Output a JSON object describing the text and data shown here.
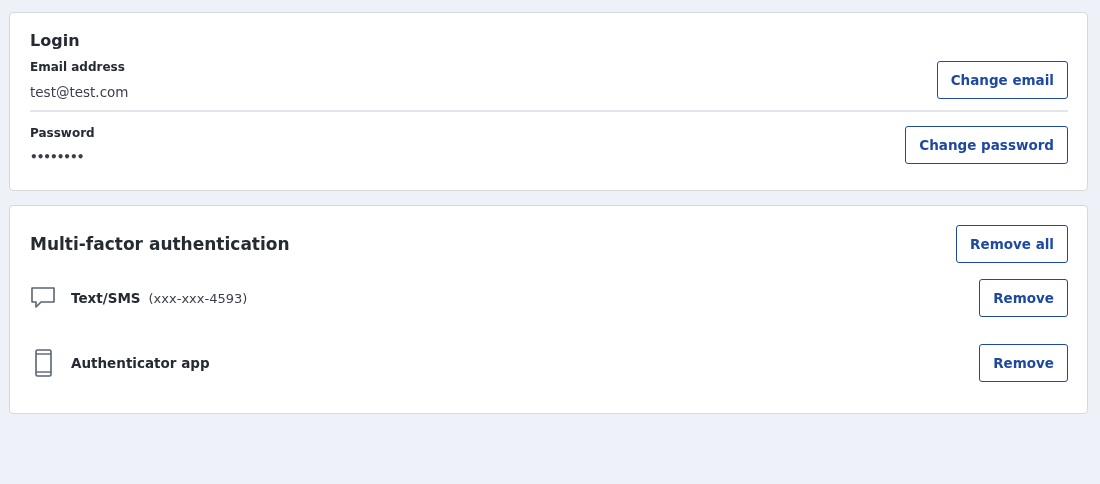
{
  "login": {
    "title": "Login",
    "fields": [
      {
        "label": "Email address",
        "value": "test@test.com",
        "kind": "email",
        "button": "Change email"
      },
      {
        "label": "Password",
        "value": "••••••••",
        "kind": "password",
        "button": "Change password"
      }
    ]
  },
  "mfa": {
    "title": "Multi-factor authentication",
    "remove_all": "Remove all",
    "factors": [
      {
        "kind": "sms",
        "name": "Text/SMS",
        "detail": "(xxx-xxx-4593)",
        "button": "Remove"
      },
      {
        "kind": "app",
        "name": "Authenticator app",
        "button": "Remove"
      }
    ]
  }
}
